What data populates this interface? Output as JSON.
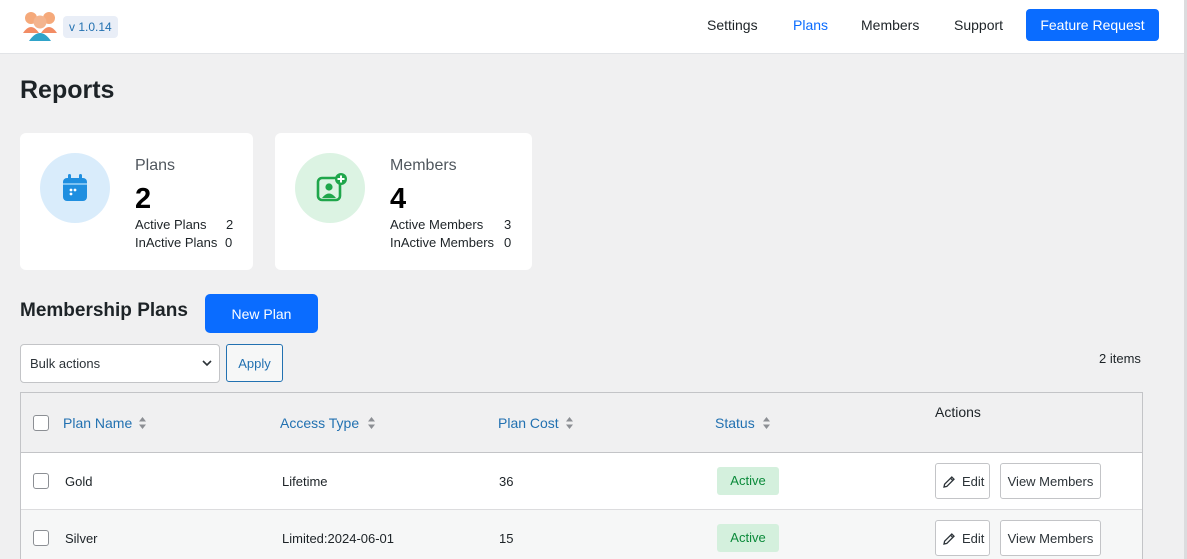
{
  "header": {
    "version": "v 1.0.14",
    "nav": {
      "settings": "Settings",
      "plans": "Plans",
      "members": "Members",
      "support": "Support"
    },
    "feature_request": "Feature Request",
    "active_nav": "Plans"
  },
  "page_title": "Reports",
  "stats": {
    "plans": {
      "label": "Plans",
      "count": "2",
      "active_label": "Active Plans",
      "active_value": "2",
      "inactive_label": "InActive Plans",
      "inactive_value": "0",
      "icon": "calendar-icon"
    },
    "members": {
      "label": "Members",
      "count": "4",
      "active_label": "Active Members",
      "active_value": "3",
      "inactive_label": "InActive Members",
      "inactive_value": "0",
      "icon": "add-member-icon"
    }
  },
  "plans_section": {
    "title": "Membership Plans",
    "new_plan": "New Plan",
    "bulk_actions": "Bulk actions",
    "apply": "Apply",
    "items_count": "2 items",
    "columns": {
      "plan_name": "Plan Name",
      "access_type": "Access Type",
      "plan_cost": "Plan Cost",
      "status": "Status",
      "actions": "Actions"
    },
    "rows": [
      {
        "name": "Gold",
        "access": "Lifetime",
        "cost": "36",
        "status": "Active",
        "edit": "Edit",
        "view": "View Members"
      },
      {
        "name": "Silver",
        "access": "Limited:2024-06-01",
        "cost": "15",
        "status": "Active",
        "edit": "Edit",
        "view": "View Members"
      }
    ]
  },
  "colors": {
    "primary": "#0a6cff",
    "link": "#2271b1",
    "active_badge_bg": "#d4f0dd",
    "active_badge_text": "#0b8a3a",
    "plans_icon_bg": "#d9ecfb",
    "members_icon_bg": "#dcf3e3"
  }
}
